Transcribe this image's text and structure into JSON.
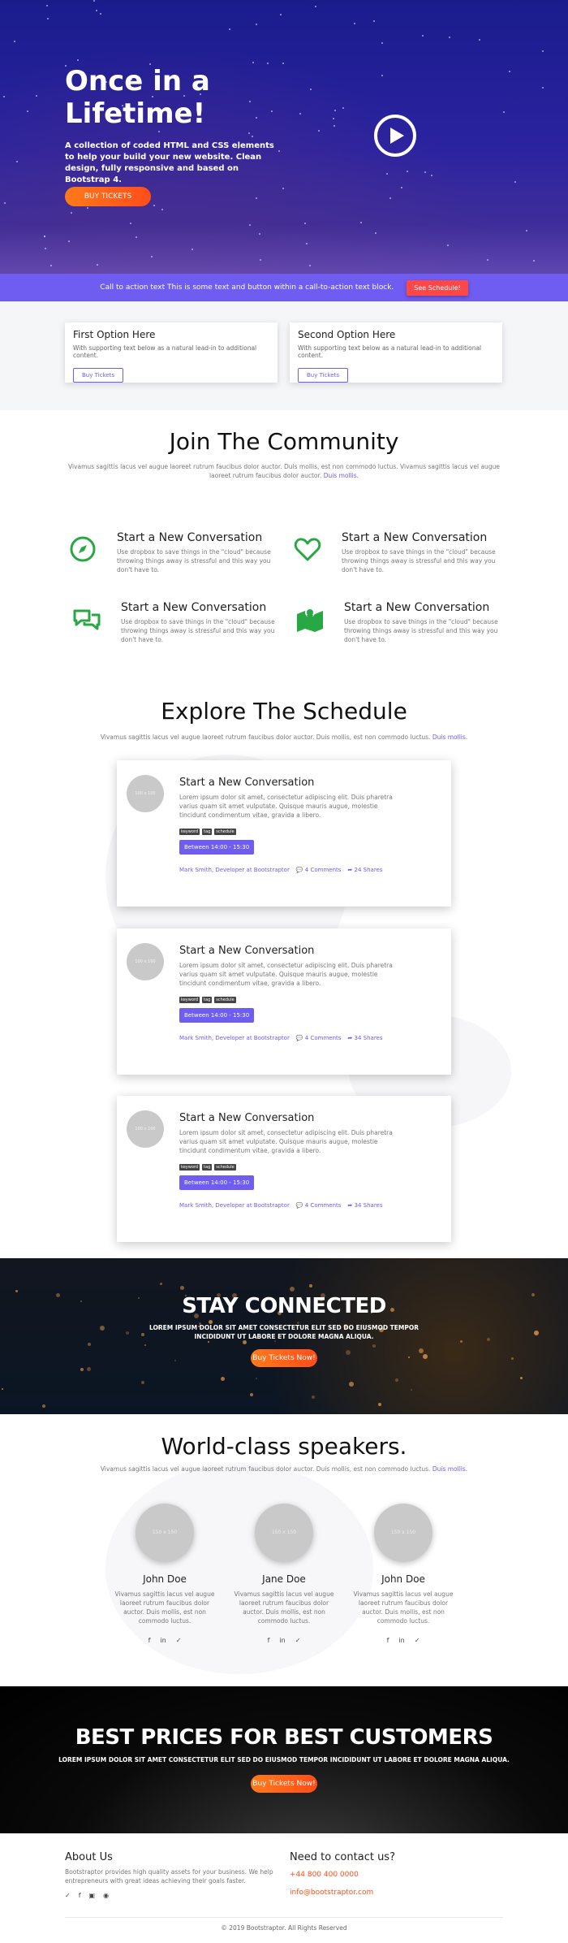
{
  "hero": {
    "title": "Once in a Lifetime!",
    "text": "A collection of coded HTML and CSS elements to help your build your new website. Clean design, fully responsive and based on Bootstrap 4.",
    "button": "BUY TICKETS",
    "play_icon": "play-icon"
  },
  "cta": {
    "text": "Call to action text This is some text and button within a call-to-action text block.",
    "button": "See Schedule!"
  },
  "options": [
    {
      "title": "First Option Here",
      "text": "With supporting text below as a natural lead-in to additional content.",
      "button": "Buy Tickets"
    },
    {
      "title": "Second Option Here",
      "text": "With supporting text below as a natural lead-in to additional content.",
      "button": "Buy Tickets"
    }
  ],
  "community": {
    "title": "Join The Community",
    "subtitle": "Vivamus sagittis lacus vel augue laoreet rutrum faucibus dolor auctor. Duis mollis, est non commodo luctus. Vivamus sagittis lacus vel augue laoreet rutrum faucibus dolor auctor.",
    "subtitle_link": "Duis mollis.",
    "features": [
      {
        "icon": "compass-icon",
        "title": "Start a New Conversation",
        "text": "Use dropbox to save things in the \"cloud\" because throwing things away is stressful and this way you don't have to."
      },
      {
        "icon": "heart-icon",
        "title": "Start a New Conversation",
        "text": "Use dropbox to save things in the \"cloud\" because throwing things away is stressful and this way you don't have to."
      },
      {
        "icon": "chat-bubbles-icon",
        "title": "Start a New Conversation",
        "text": "Use dropbox to save things in the \"cloud\" because throwing things away is stressful and this way you don't have to."
      },
      {
        "icon": "map-pin-icon",
        "title": "Start a New Conversation",
        "text": "Use dropbox to save things in the \"cloud\" because throwing things away is stressful and this way you don't have to."
      }
    ]
  },
  "schedule": {
    "title": "Explore The Schedule",
    "subtitle": "Vivamus sagittis lacus vel augue laoreet rutrum faucibus dolor auctor. Duis mollis, est non commodo luctus.",
    "subtitle_link": "Duis mollis.",
    "items": [
      {
        "avatar": "100 x 100",
        "title": "Start a New Conversation",
        "text": "Lorem ipsum dolor sit amet, consectetur adipiscing elit. Duis pharetra varius quam sit amet vulputate. Quisque mauris augue, molestie tincidunt condimentum vitae, gravida a libero.",
        "tags": [
          "keyword",
          "tag",
          "schedule"
        ],
        "time": "Between 14:00 - 15:30",
        "author": "Mark Smith, Developer at Bootstraptor",
        "comments": "4 Comments",
        "shares": "24 Shares"
      },
      {
        "avatar": "100 x 100",
        "title": "Start a New Conversation",
        "text": "Lorem ipsum dolor sit amet, consectetur adipiscing elit. Duis pharetra varius quam sit amet vulputate. Quisque mauris augue, molestie tincidunt condimentum vitae, gravida a libero.",
        "tags": [
          "keyword",
          "tag",
          "schedule"
        ],
        "time": "Between 14:00 - 15:30",
        "author": "Mark Smith, Developer at Bootstraptor",
        "comments": "4 Comments",
        "shares": "34 Shares"
      },
      {
        "avatar": "100 x 100",
        "title": "Start a New Conversation",
        "text": "Lorem ipsum dolor sit amet, consectetur adipiscing elit. Duis pharetra varius quam sit amet vulputate. Quisque mauris augue, molestie tincidunt condimentum vitae, gravida a libero.",
        "tags": [
          "keyword",
          "tag",
          "schedule"
        ],
        "time": "Between 14:00 - 15:30",
        "author": "Mark Smith, Developer at Bootstraptor",
        "comments": "4 Comments",
        "shares": "34 Shares"
      }
    ]
  },
  "stay": {
    "title": "STAY CONNECTED",
    "text": "LOREM IPSUM DOLOR SIT AMET CONSECTETUR ELIT SED DO EIUSMOD TEMPOR INCIDIDUNT UT LABORE ET DOLORE MAGNA ALIQUA.",
    "button": "Buy Tickets Now!"
  },
  "speakers": {
    "title": "World-class speakers.",
    "subtitle": "Vivamus sagittis lacus vel augue laoreet rutrum faucibus dolor auctor. Duis mollis, est non commodo luctus.",
    "subtitle_link": "Duis mollis.",
    "people": [
      {
        "photo": "150 x 150",
        "name": "John Doe",
        "bio": "Vivamus sagittis lacus vel augue laoreet rutrum faucibus dolor auctor. Duis mollis, est non commodo luctus."
      },
      {
        "photo": "150 x 150",
        "name": "Jane Doe",
        "bio": "Vivamus sagittis lacus vel augue laoreet rutrum faucibus dolor auctor. Duis mollis, est non commodo luctus."
      },
      {
        "photo": "150 x 150",
        "name": "John Doe",
        "bio": "Vivamus sagittis lacus vel augue laoreet rutrum faucibus dolor auctor. Duis mollis, est non commodo luctus."
      }
    ],
    "social_icons": [
      "facebook-icon",
      "linkedin-icon",
      "twitter-icon"
    ]
  },
  "prices": {
    "title": "BEST PRICES FOR BEST CUSTOMERS",
    "text": "LOREM IPSUM DOLOR SIT AMET CONSECTETUR ELIT SED DO EIUSMOD TEMPOR INCIDIDUNT UT LABORE ET DOLORE MAGNA ALIQUA.",
    "button": "Buy Tickets Now!"
  },
  "footer": {
    "about_title": "About Us",
    "about_text": "Bootstraptor provides high quality assets for your business. We help entrepreneurs with great ideas achieving their goals faster.",
    "social_icons": [
      "twitter-icon",
      "facebook-icon",
      "instagram-icon",
      "pinterest-icon"
    ],
    "contact_title": "Need to contact us?",
    "phone": "+44 800 400 0000",
    "email": "info@bootstraptor.com",
    "copyright": "© 2019 Bootstraptor. All Rights Reserved"
  },
  "colors": {
    "accent": "#6f5cf0",
    "orange": "#ff5a1a",
    "green": "#28a745",
    "red": "#ff4747"
  }
}
